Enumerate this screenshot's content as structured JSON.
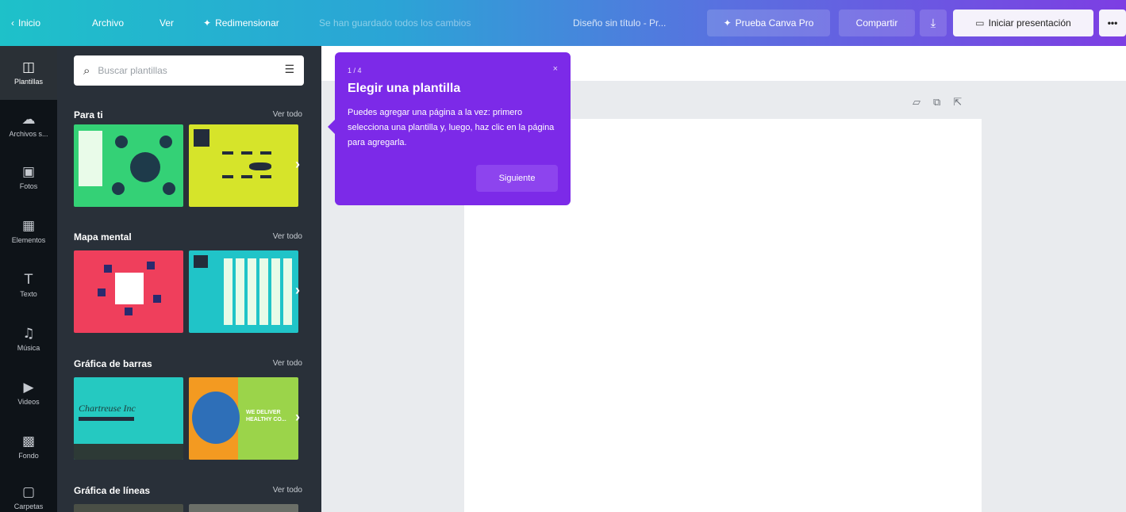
{
  "topbar": {
    "home": "Inicio",
    "file": "Archivo",
    "view": "Ver",
    "resize": "Redimensionar",
    "autosave_status": "Se han guardado todos los cambios",
    "doc_title": "Diseño sin título - Pr...",
    "try_pro": "Prueba Canva Pro",
    "share": "Compartir",
    "download_icon": "download-icon",
    "present": "Iniciar presentación",
    "more": "•••"
  },
  "rail": {
    "items": [
      {
        "label": "Plantillas",
        "icon": "templates-icon"
      },
      {
        "label": "Archivos s...",
        "icon": "uploads-icon"
      },
      {
        "label": "Fotos",
        "icon": "photos-icon"
      },
      {
        "label": "Elementos",
        "icon": "elements-icon"
      },
      {
        "label": "Texto",
        "icon": "text-icon"
      },
      {
        "label": "Música",
        "icon": "music-icon"
      },
      {
        "label": "Videos",
        "icon": "videos-icon"
      },
      {
        "label": "Fondo",
        "icon": "background-icon"
      },
      {
        "label": "Carpetas",
        "icon": "folders-icon"
      }
    ]
  },
  "panel": {
    "search_placeholder": "Buscar plantillas",
    "sections": [
      {
        "title": "Para ti",
        "link": "Ver todo"
      },
      {
        "title": "Mapa mental",
        "link": "Ver todo"
      },
      {
        "title": "Gráfica de barras",
        "link": "Ver todo"
      },
      {
        "title": "Gráfica de líneas",
        "link": "Ver todo"
      }
    ],
    "thumb_texts": {
      "bar1": "Chartreuse Inc",
      "bar2": "WE DELIVER HEALTHY CO..."
    }
  },
  "tooltip": {
    "step": "1 / 4",
    "close": "×",
    "title": "Elegir una plantilla",
    "body": "Puedes agregar una página a la vez: primero selecciona una plantilla y, luego, haz clic en la página para agregarla.",
    "next": "Siguiente"
  },
  "colors": {
    "accent_purple": "#7c2ae8",
    "rail_bg": "#0e1318",
    "panel_bg": "#293039"
  }
}
